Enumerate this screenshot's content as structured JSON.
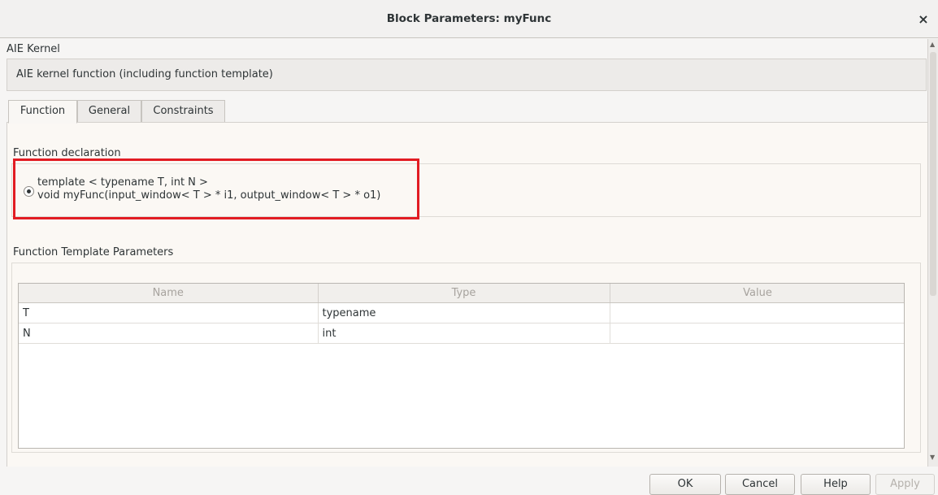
{
  "window": {
    "title": "Block Parameters: myFunc",
    "close_symbol": "×"
  },
  "section": {
    "title": "AIE Kernel",
    "description": "AIE kernel function (including function template)"
  },
  "tabs": [
    {
      "label": "Function",
      "active": true
    },
    {
      "label": "General",
      "active": false
    },
    {
      "label": "Constraints",
      "active": false
    }
  ],
  "function_declaration": {
    "label": "Function declaration",
    "line1": "template < typename T, int N >",
    "line2": "void myFunc(input_window< T > * i1, output_window< T > * o1)",
    "selected": true
  },
  "template_params": {
    "label": "Function Template Parameters",
    "columns": [
      "Name",
      "Type",
      "Value"
    ],
    "rows": [
      {
        "name": "T",
        "type": "typename",
        "value": ""
      },
      {
        "name": "N",
        "type": "int",
        "value": ""
      }
    ]
  },
  "buttons": {
    "ok": "OK",
    "cancel": "Cancel",
    "help": "Help",
    "apply": "Apply"
  },
  "colors": {
    "highlight": "#e21c23"
  }
}
